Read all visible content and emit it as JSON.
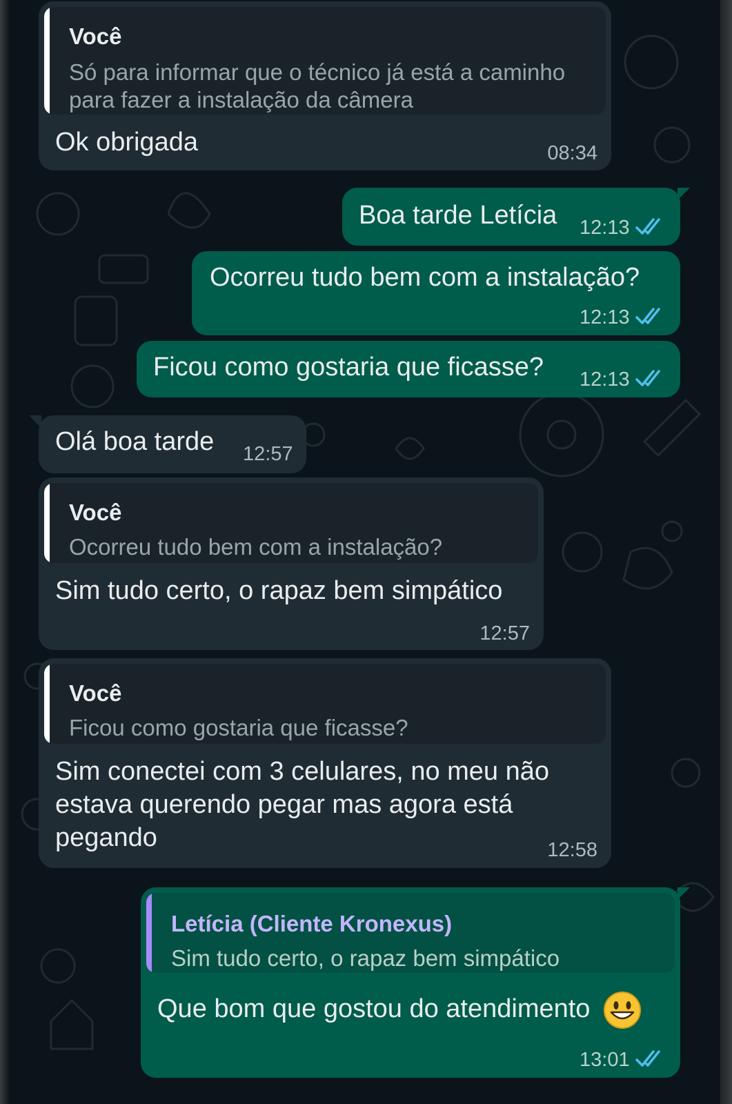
{
  "messages": [
    {
      "id": "m1",
      "direction": "incoming",
      "quote": {
        "author": "Você",
        "text_lines": [
          "Só para informar que o técnico já está a caminho",
          "para fazer a instalação da câmera"
        ]
      },
      "text": "Ok obrigada",
      "time": "08:34"
    },
    {
      "id": "m2",
      "direction": "outgoing",
      "text": "Boa tarde Letícia",
      "time": "12:13",
      "status": "read"
    },
    {
      "id": "m3",
      "direction": "outgoing",
      "text": "Ocorreu tudo bem com a instalação?",
      "time": "12:13",
      "status": "read"
    },
    {
      "id": "m4",
      "direction": "outgoing",
      "text": "Ficou como gostaria que ficasse?",
      "time": "12:13",
      "status": "read"
    },
    {
      "id": "m5",
      "direction": "incoming",
      "text": "Olá boa tarde",
      "time": "12:57"
    },
    {
      "id": "m6",
      "direction": "incoming",
      "quote": {
        "author": "Você",
        "text_lines": [
          "Ocorreu tudo bem com a instalação?"
        ]
      },
      "text": "Sim tudo certo, o rapaz bem simpático",
      "time": "12:57"
    },
    {
      "id": "m7",
      "direction": "incoming",
      "quote": {
        "author": "Você",
        "text_lines": [
          "Ficou como gostaria que ficasse?"
        ]
      },
      "text_lines": [
        "Sim conectei com 3 celulares, no meu não",
        "estava querendo pegar mas agora está",
        "pegando"
      ],
      "time": "12:58"
    },
    {
      "id": "m8",
      "direction": "outgoing",
      "quote": {
        "author": "Letícia (Cliente Kronexus)",
        "text_lines": [
          "Sim tudo certo, o rapaz bem simpático"
        ]
      },
      "text": "Que bom que gostou do atendimento",
      "emoji": "grinning-face-emoji",
      "time": "13:01",
      "status": "read"
    }
  ],
  "colors": {
    "incoming_bubble": "#202c33",
    "outgoing_bubble": "#005c4b",
    "read_ticks": "#53bdeb",
    "quote_bar_self": "#ffffff",
    "quote_bar_contact": "#a78bfa",
    "contact_name": "#c4b5fd",
    "background": "#0b141a"
  }
}
